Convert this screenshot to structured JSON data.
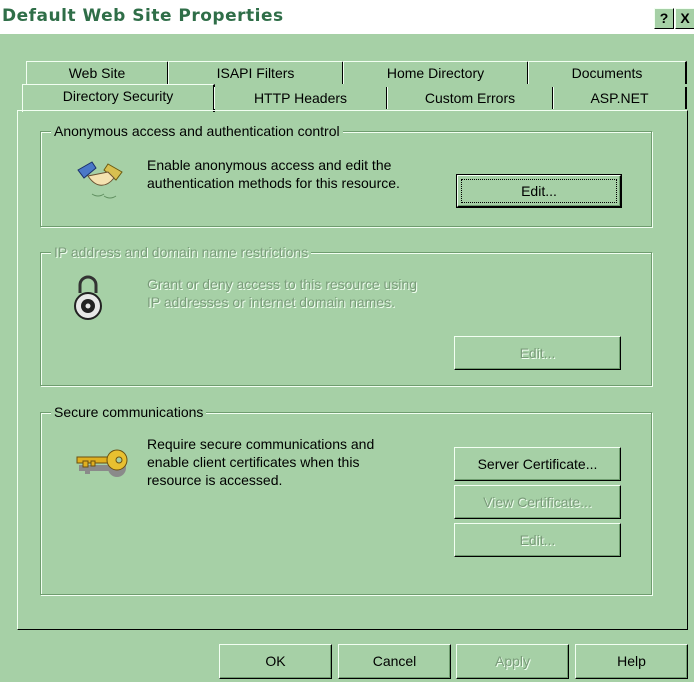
{
  "window": {
    "title": "Default Web Site Properties",
    "help_glyph": "?",
    "close_glyph": "X"
  },
  "tabs_back": [
    "Web Site",
    "ISAPI Filters",
    "Home Directory",
    "Documents"
  ],
  "tabs_front": [
    "Directory Security",
    "HTTP Headers",
    "Custom Errors",
    "ASP.NET"
  ],
  "active_tab": "Directory Security",
  "anon": {
    "legend": "Anonymous access and authentication control",
    "text": "Enable anonymous access and edit the\nauthentication methods for this resource.",
    "edit": "Edit...",
    "icon": "handshake-icon"
  },
  "ip": {
    "legend": "IP address and domain name restrictions",
    "text": "Grant or deny access to this resource using\nIP addresses or internet domain names.",
    "edit": "Edit...",
    "icon": "padlock-icon"
  },
  "secure": {
    "legend": "Secure communications",
    "text": "Require secure communications and\nenable client certificates when this\nresource is accessed.",
    "server_cert": "Server Certificate...",
    "view_cert": "View Certificate...",
    "edit": "Edit...",
    "icon": "key-icon"
  },
  "footer": {
    "ok": "OK",
    "cancel": "Cancel",
    "apply": "Apply",
    "help": "Help"
  },
  "colors": {
    "face": "#a6d0a6",
    "highlight": "#f2fff2",
    "shadow": "#6f9c6f",
    "title_text": "#2f6e48"
  }
}
